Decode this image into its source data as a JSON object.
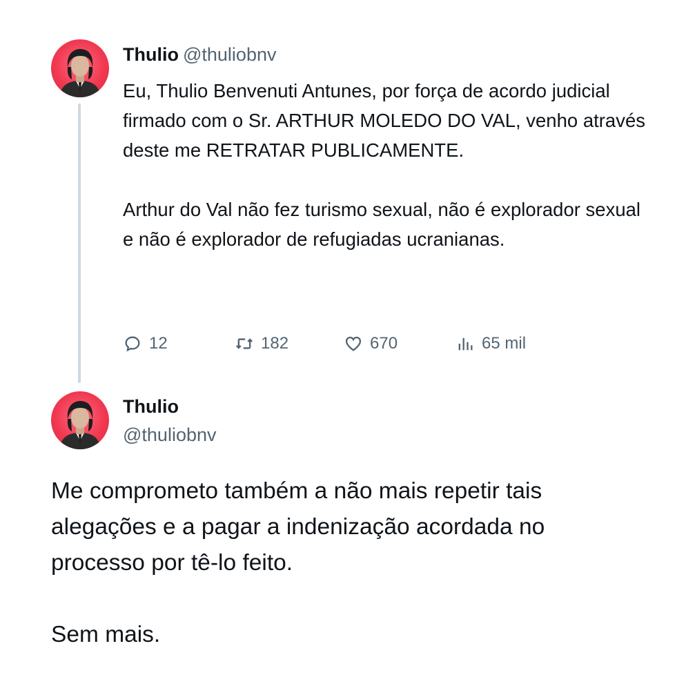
{
  "tweet1": {
    "display_name": "Thulio",
    "handle": "@thuliobnv",
    "paragraphs": [
      "Eu, Thulio Benvenuti Antunes, por força de acordo judicial firmado com o Sr. ARTHUR MOLEDO DO VAL, venho através deste me RETRATAR PUBLICAMENTE.",
      "Arthur do Val não fez turismo sexual, não é explorador sexual e não é explorador de refugiadas ucranianas."
    ],
    "metrics": {
      "replies": "12",
      "retweets": "182",
      "likes": "670",
      "views": "65 mil"
    }
  },
  "tweet2": {
    "display_name": "Thulio",
    "handle": "@thuliobnv",
    "paragraphs": [
      "Me comprometo também a não mais repetir tais alegações e a pagar a indenização acordada no processo por tê-lo feito.",
      "Sem mais."
    ]
  },
  "icons": {
    "reply": "reply-icon",
    "retweet": "retweet-icon",
    "like": "heart-icon",
    "views": "views-icon"
  },
  "colors": {
    "text": "#0f1419",
    "secondary": "#536471",
    "thread_line": "#cfd9de",
    "avatar_bg": "#f13a52"
  }
}
